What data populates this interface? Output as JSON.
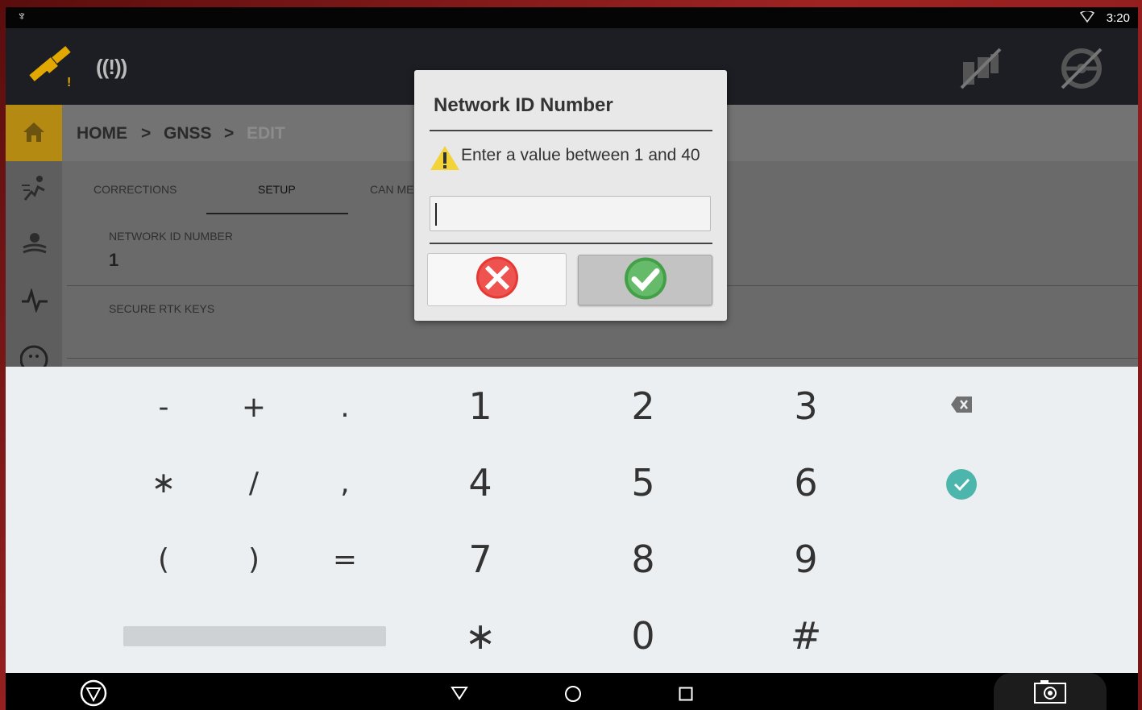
{
  "status_bar": {
    "time": "3:20",
    "usb_icon": "usb-icon",
    "wifi_icon": "wifi-icon"
  },
  "app_bar": {
    "gps_icon": "satellite-warning-icon",
    "signal_icon": "signal-alert-icon",
    "signal_text": "((!))"
  },
  "breadcrumb": {
    "home": "HOME",
    "sep1": ">",
    "gnss": "GNSS",
    "sep2": ">",
    "edit": "EDIT"
  },
  "tabs": [
    {
      "label": "CORRECTIONS"
    },
    {
      "label": "SETUP"
    },
    {
      "label": "CAN ME"
    }
  ],
  "fields": {
    "network_id_label": "NETWORK ID NUMBER",
    "network_id_value": "1",
    "secure_rtk_label": "SECURE RTK KEYS"
  },
  "dialog": {
    "title": "Network ID Number",
    "message": "Enter a value between 1 and 40",
    "input_value": "",
    "cancel_icon": "red-x-icon",
    "ok_icon": "green-check-icon"
  },
  "keyboard": {
    "rows": [
      [
        "-",
        "+",
        ".",
        "1",
        "2",
        "3"
      ],
      [
        "∗",
        "/",
        ",",
        "4",
        "5",
        "6"
      ],
      [
        "(",
        ")",
        "=",
        "7",
        "8",
        "9"
      ],
      [
        "∗",
        "0",
        "#"
      ]
    ],
    "backspace_icon": "backspace-icon",
    "done_icon": "done-check-icon"
  },
  "nav_bar": {
    "back": "back-icon",
    "home": "home-circle-icon",
    "recents": "recents-icon",
    "app": "brand-logo-icon",
    "screenshot": "camera-icon"
  },
  "colors": {
    "accent_home": "#b58a12",
    "done": "#4db6ac",
    "cancel_red": "#e53935",
    "ok_green": "#43a047"
  }
}
